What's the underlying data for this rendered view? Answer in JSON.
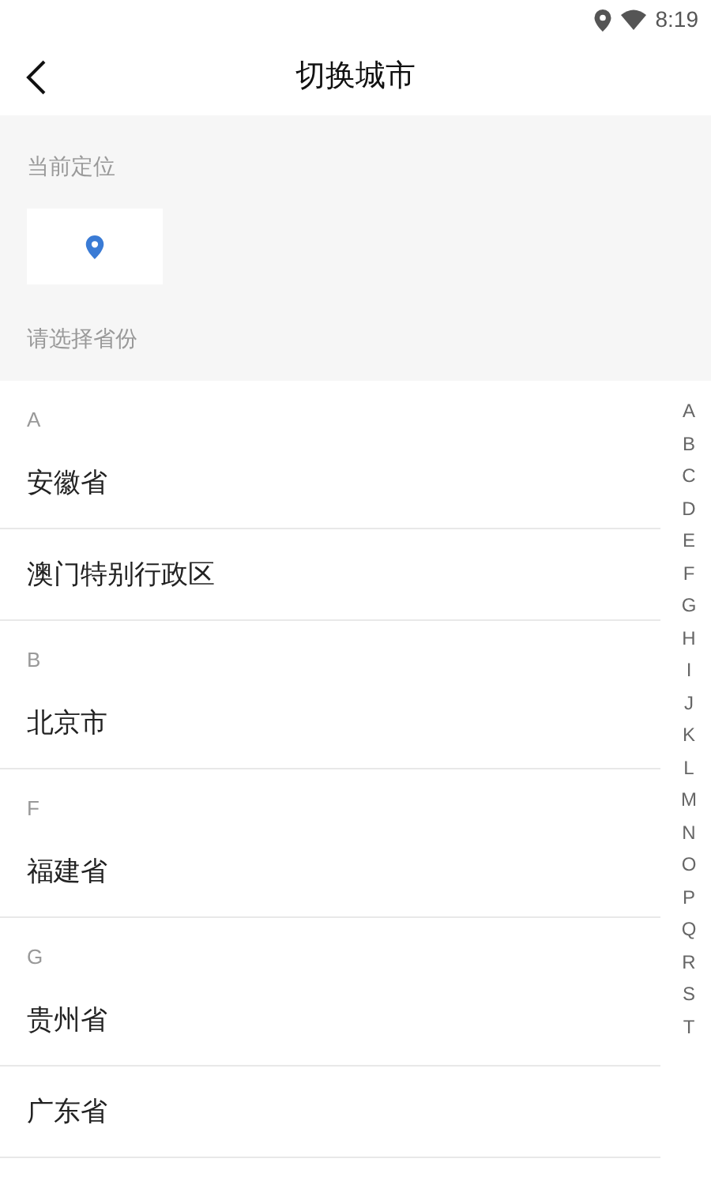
{
  "status_bar": {
    "time": "8:19"
  },
  "header": {
    "title": "切换城市"
  },
  "location": {
    "label": "当前定位"
  },
  "province_prompt": "请选择省份",
  "sections": [
    {
      "letter": "A",
      "items": [
        "安徽省",
        "澳门特别行政区"
      ]
    },
    {
      "letter": "B",
      "items": [
        "北京市"
      ]
    },
    {
      "letter": "F",
      "items": [
        "福建省"
      ]
    },
    {
      "letter": "G",
      "items": [
        "贵州省",
        "广东省"
      ]
    }
  ],
  "index_letters": [
    "A",
    "B",
    "C",
    "D",
    "E",
    "F",
    "G",
    "H",
    "I",
    "J",
    "K",
    "L",
    "M",
    "N",
    "O",
    "P",
    "Q",
    "R",
    "S",
    "T"
  ]
}
